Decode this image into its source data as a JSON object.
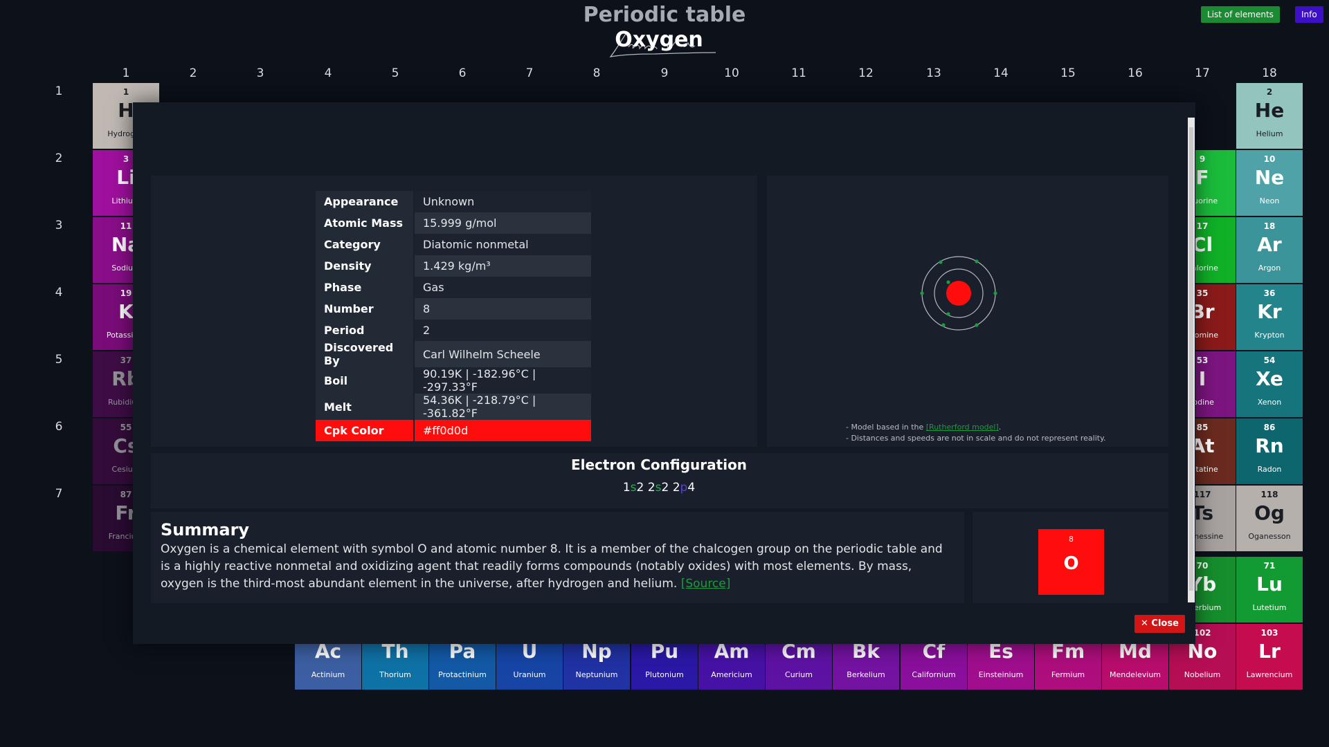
{
  "app": {
    "title": "Periodic table"
  },
  "header": {
    "list_button": "List of elements",
    "info_button": "Info"
  },
  "groups": [
    "1",
    "2",
    "3",
    "4",
    "5",
    "6",
    "7",
    "8",
    "9",
    "10",
    "11",
    "12",
    "13",
    "14",
    "15",
    "16",
    "17",
    "18"
  ],
  "periods": [
    "1",
    "2",
    "3",
    "4",
    "5",
    "6",
    "7"
  ],
  "tiles": [
    {
      "num": "1",
      "sym": "H",
      "name": "Hydrogen",
      "color": "#bfb8b3"
    },
    {
      "num": "3",
      "sym": "Li",
      "name": "Lithium",
      "color": "#a0109f"
    },
    {
      "num": "11",
      "sym": "Na",
      "name": "Sodium",
      "color": "#8a0e8a"
    },
    {
      "num": "19",
      "sym": "K",
      "name": "Potassium",
      "color": "#7a0c7a"
    },
    {
      "num": "37",
      "sym": "Rb",
      "name": "Rubidium",
      "color": "#680a69"
    },
    {
      "num": "55",
      "sym": "Cs",
      "name": "Cesium",
      "color": "#560957"
    },
    {
      "num": "87",
      "sym": "Fr",
      "name": "Francium",
      "color": "#440746"
    },
    {
      "num": "2",
      "sym": "He",
      "name": "Helium",
      "color": "#94c4be"
    },
    {
      "num": "10",
      "sym": "Ne",
      "name": "Neon",
      "color": "#4fa3a8"
    },
    {
      "num": "18",
      "sym": "Ar",
      "name": "Argon",
      "color": "#3a9499"
    },
    {
      "num": "36",
      "sym": "Kr",
      "name": "Krypton",
      "color": "#24848b"
    },
    {
      "num": "54",
      "sym": "Xe",
      "name": "Xenon",
      "color": "#16747c"
    },
    {
      "num": "86",
      "sym": "Rn",
      "name": "Radon",
      "color": "#0d656d"
    },
    {
      "num": "118",
      "sym": "Og",
      "name": "Oganesson",
      "color": "#b6b0ad"
    },
    {
      "num": "71",
      "sym": "Lu",
      "name": "Lutetium",
      "color": "#129b32"
    },
    {
      "num": "103",
      "sym": "Lr",
      "name": "Lawrencium",
      "color": "#c50c4e"
    },
    {
      "num": "9",
      "sym": "F",
      "name": "Fluorine",
      "color": "#1bbc3b"
    },
    {
      "num": "17",
      "sym": "Cl",
      "name": "Chlorine",
      "color": "#10b027"
    },
    {
      "num": "35",
      "sym": "Br",
      "name": "Bromine",
      "color": "#8b1a1a"
    },
    {
      "num": "53",
      "sym": "I",
      "name": "Iodine",
      "color": "#7c1580"
    },
    {
      "num": "85",
      "sym": "At",
      "name": "Astatine",
      "color": "#6b2a1f"
    },
    {
      "num": "117",
      "sym": "Ts",
      "name": "Tennessine",
      "color": "#a7a19f"
    },
    {
      "num": "70",
      "sym": "Yb",
      "name": "Ytterbium",
      "color": "#168e2d"
    },
    {
      "num": "102",
      "sym": "No",
      "name": "Nobelium",
      "color": "#b50e54"
    },
    {
      "num": "",
      "sym": "Ac",
      "name": "Actinium",
      "color": "#3c5fa3"
    },
    {
      "num": "",
      "sym": "Th",
      "name": "Thorium",
      "color": "#0f72a6"
    },
    {
      "num": "",
      "sym": "Pa",
      "name": "Protactinium",
      "color": "#1359a6"
    },
    {
      "num": "",
      "sym": "U",
      "name": "Uranium",
      "color": "#1645a6"
    },
    {
      "num": "",
      "sym": "Np",
      "name": "Neptunium",
      "color": "#2032a4"
    },
    {
      "num": "",
      "sym": "Pu",
      "name": "Plutonium",
      "color": "#2a18a6"
    },
    {
      "num": "",
      "sym": "Am",
      "name": "Americium",
      "color": "#4612a6"
    },
    {
      "num": "",
      "sym": "Cm",
      "name": "Curium",
      "color": "#5e12a4"
    },
    {
      "num": "",
      "sym": "Bk",
      "name": "Berkelium",
      "color": "#7412a2"
    },
    {
      "num": "",
      "sym": "Cf",
      "name": "Californium",
      "color": "#8a0f9c"
    },
    {
      "num": "",
      "sym": "Es",
      "name": "Einsteinium",
      "color": "#a00e8e"
    },
    {
      "num": "",
      "sym": "Fm",
      "name": "Fermium",
      "color": "#ae0e7d"
    },
    {
      "num": "",
      "sym": "Md",
      "name": "Mendelevium",
      "color": "#b80d6c"
    },
    {
      "num": "",
      "sym": "No",
      "name": "Nobelium",
      "color": "#b50e54"
    },
    {
      "num": "",
      "sym": "Lr",
      "name": "Lawrencium",
      "color": "#c50c4e"
    }
  ],
  "modal": {
    "title": "Oxygen",
    "properties": [
      {
        "key": "Appearance",
        "value": "Unknown"
      },
      {
        "key": "Atomic Mass",
        "value": "15.999 g/mol"
      },
      {
        "key": "Category",
        "value": "Diatomic nonmetal"
      },
      {
        "key": "Density",
        "value": "1.429 kg/m³"
      },
      {
        "key": "Phase",
        "value": "Gas"
      },
      {
        "key": "Number",
        "value": "8"
      },
      {
        "key": "Period",
        "value": "2"
      },
      {
        "key": "Discovered By",
        "value": "Carl Wilhelm Scheele"
      },
      {
        "key": "Boil",
        "value": "90.19K | -182.96°C | -297.33°F"
      },
      {
        "key": "Melt",
        "value": "54.36K | -218.79°C | -361.82°F"
      },
      {
        "key": "Cpk Color",
        "value": "#ff0d0d"
      }
    ],
    "model_note": {
      "line1_prefix": "- Model based in the ",
      "line1_link": "[Rutherford model]",
      "line1_suffix": ".",
      "line2": "- Distances and speeds are not in scale and do not represent reality."
    },
    "electron_config": {
      "title": "Electron Configuration",
      "shells": [
        {
          "n": "1",
          "l": "s",
          "e": "2"
        },
        {
          "n": "2",
          "l": "s",
          "e": "2"
        },
        {
          "n": "2",
          "l": "p",
          "e": "4"
        }
      ]
    },
    "summary": {
      "title": "Summary",
      "text": "Oxygen is a chemical element with symbol O and atomic number 8. It is a member of the chalcogen group on the periodic table and is a highly reactive nonmetal and oxidizing agent that readily forms compounds (notably oxides) with most elements. By mass, oxygen is the third-most abundant element in the universe, after hydrogen and helium.",
      "source_label": "[Source]"
    },
    "tile": {
      "number": "8",
      "symbol": "O",
      "color": "#ff0d0d"
    },
    "close_label": "✕ Close"
  }
}
